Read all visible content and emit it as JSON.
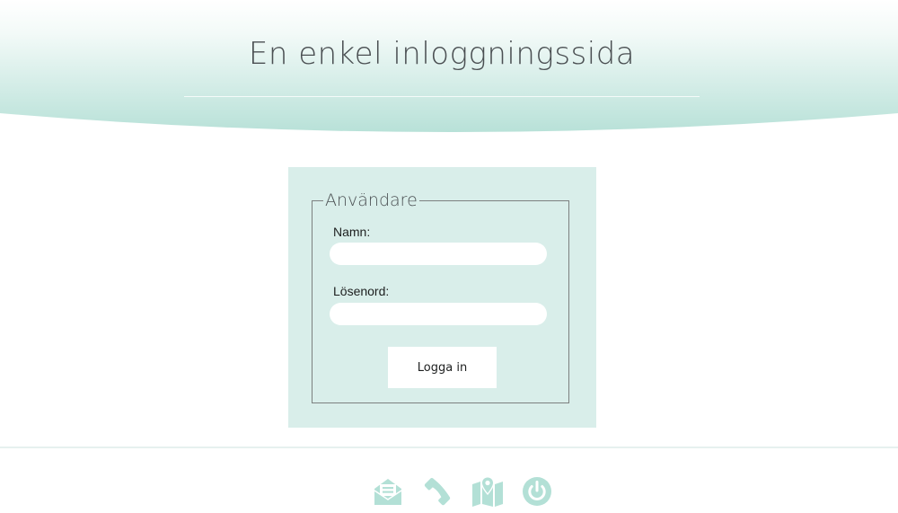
{
  "header": {
    "title": "En enkel inloggningssida"
  },
  "login_form": {
    "legend": "Användare",
    "name_label": "Namn:",
    "name_value": "",
    "password_label": "Lösenord:",
    "password_value": "",
    "submit_label": "Logga in"
  },
  "footer": {
    "icons": [
      {
        "icon": "mail-icon"
      },
      {
        "icon": "phone-icon"
      },
      {
        "icon": "map-icon"
      },
      {
        "icon": "power-icon"
      }
    ]
  },
  "colors": {
    "accent": "#b3e0d6",
    "panel": "#d9eeea",
    "text": "#4a4f52"
  }
}
